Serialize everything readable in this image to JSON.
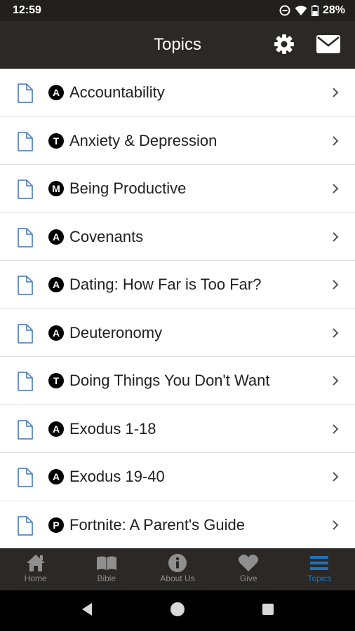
{
  "status_bar": {
    "time": "12:59",
    "battery": "28%"
  },
  "app_bar": {
    "title": "Topics"
  },
  "topics": [
    {
      "badge": "A",
      "label": "Accountability"
    },
    {
      "badge": "T",
      "label": "Anxiety & Depression"
    },
    {
      "badge": "M",
      "label": "Being Productive"
    },
    {
      "badge": "A",
      "label": "Covenants"
    },
    {
      "badge": "A",
      "label": "Dating: How Far is Too Far?"
    },
    {
      "badge": "A",
      "label": "Deuteronomy"
    },
    {
      "badge": "T",
      "label": "Doing Things You Don't Want"
    },
    {
      "badge": "A",
      "label": "Exodus 1-18"
    },
    {
      "badge": "A",
      "label": "Exodus 19-40"
    },
    {
      "badge": "P",
      "label": "Fortnite: A Parent's Guide"
    }
  ],
  "bottom_nav": [
    {
      "label": "Home",
      "icon": "home-icon"
    },
    {
      "label": "Bible",
      "icon": "bible-icon"
    },
    {
      "label": "About Us",
      "icon": "info-icon"
    },
    {
      "label": "Give",
      "icon": "heart-icon"
    },
    {
      "label": "Topics",
      "icon": "menu-icon",
      "active": true
    }
  ],
  "colors": {
    "app_bar": "#2b2826",
    "status_bar": "#221f1e",
    "active_tab": "#1e73be",
    "inactive_tab": "#8f8f8f",
    "doc_icon": "#5b86c0"
  }
}
